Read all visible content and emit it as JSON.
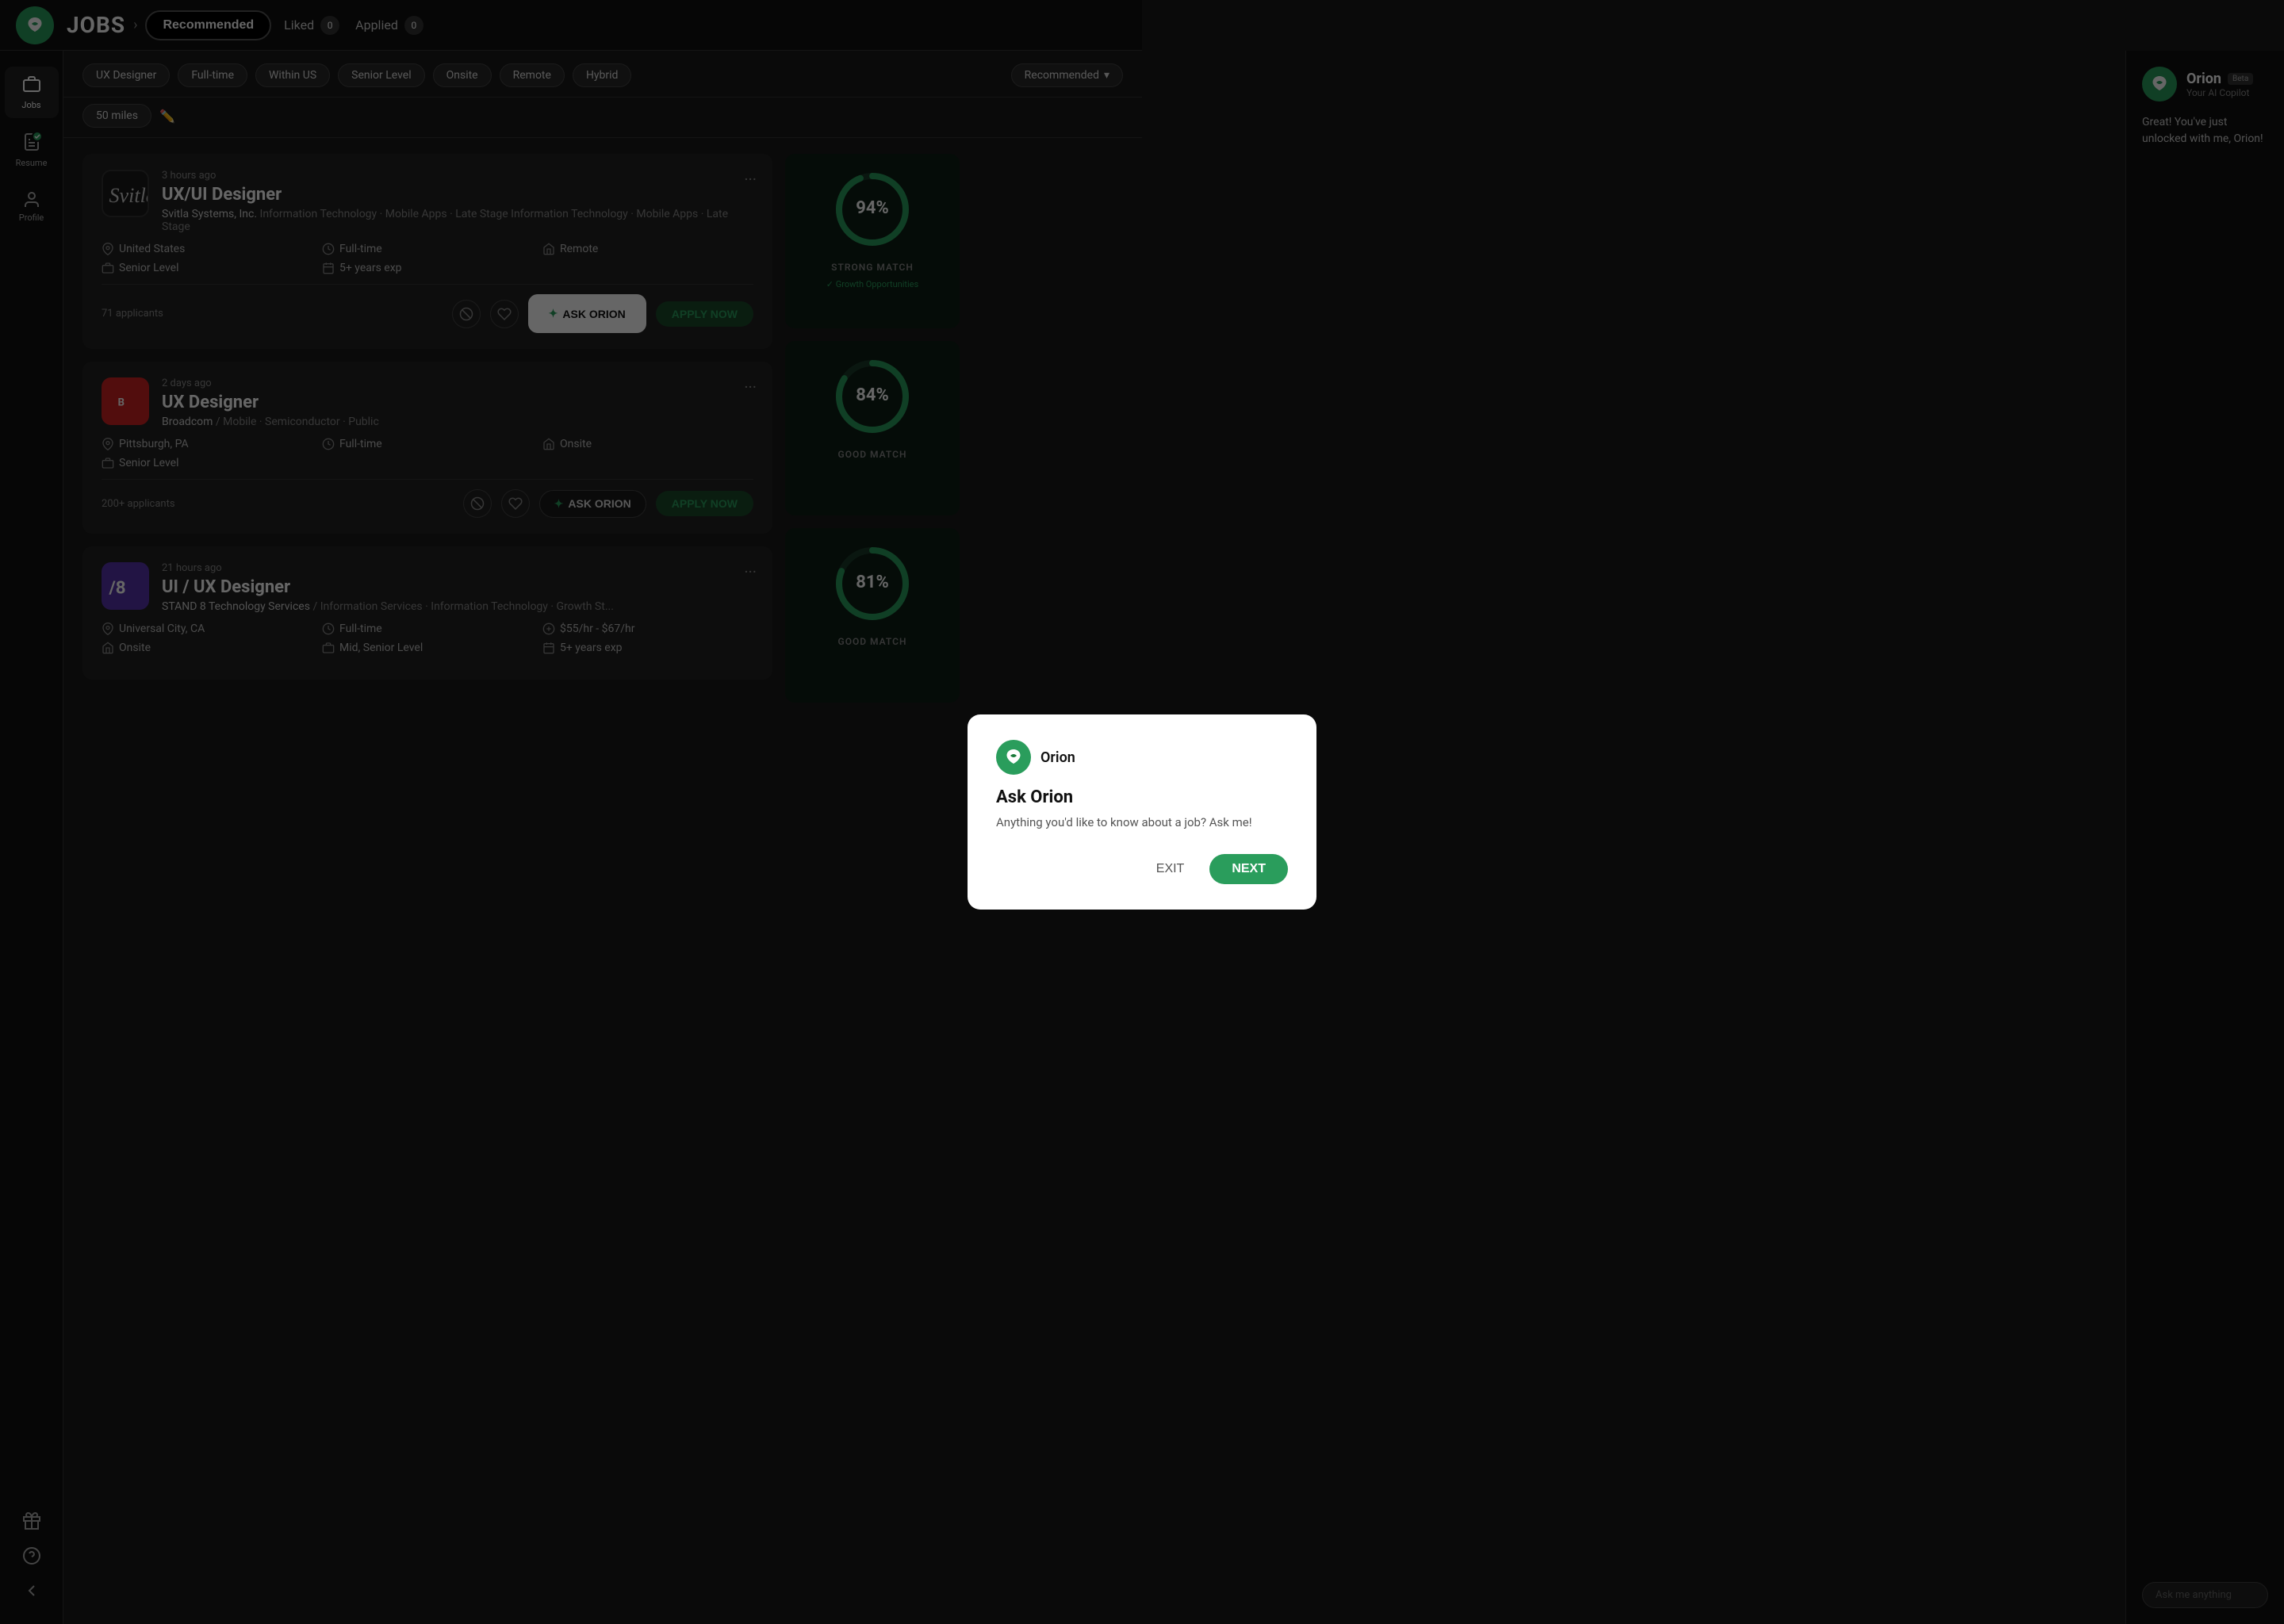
{
  "topNav": {
    "title": "JOBS",
    "tabs": [
      {
        "id": "recommended",
        "label": "Recommended",
        "active": true
      },
      {
        "id": "liked",
        "label": "Liked",
        "count": 0
      },
      {
        "id": "applied",
        "label": "Applied",
        "count": 0
      }
    ]
  },
  "filters": {
    "tags": [
      "UX Designer",
      "Full-time",
      "Within US",
      "Senior Level",
      "Onsite",
      "Remote",
      "Hybrid"
    ],
    "distance": "50 miles",
    "sort": "Recommended"
  },
  "jobs": [
    {
      "id": "job1",
      "time": "3 hours ago",
      "title": "UX/UI Designer",
      "company": "Svitla Systems, Inc.",
      "industry": "Information Technology · Mobile Apps · Late Stage",
      "location": "United States",
      "type": "Full-time",
      "workMode": "Remote",
      "level": "Senior Level",
      "experience": "5+ years exp",
      "applicants": "71 applicants",
      "match": 94,
      "matchLabel": "STRONG MATCH",
      "matchTag": "Growth Opportunities"
    },
    {
      "id": "job2",
      "time": "2 days ago",
      "title": "UX Designer",
      "company": "Broadcom",
      "industry": "Mobile · Semiconductor · Public",
      "location": "Pittsburgh, PA",
      "type": "Full-time",
      "workMode": "Onsite",
      "level": "Senior Level",
      "experience": "",
      "applicants": "200+ applicants",
      "match": 84,
      "matchLabel": "GOOD MATCH",
      "matchTag": ""
    },
    {
      "id": "job3",
      "time": "21 hours ago",
      "title": "UI / UX Designer",
      "company": "STAND 8 Technology Services",
      "industry": "Information Services · Information Technology · Growth St...",
      "location": "Universal City, CA",
      "type": "Full-time",
      "workMode": "Onsite",
      "level": "Mid, Senior Level",
      "experience": "5+ years exp",
      "salary": "$55/hr - $67/hr",
      "applicants": "",
      "match": 81,
      "matchLabel": "GOOD MATCH",
      "matchTag": ""
    }
  ],
  "orionSidebar": {
    "name": "Orion",
    "beta": "Beta",
    "subtitle": "Your AI Copilot",
    "message": "Great! You've just unlocked with me, Orion!",
    "askPlaceholder": "Ask me anything"
  },
  "modal": {
    "orionName": "Orion",
    "title": "Ask Orion",
    "description": "Anything you'd like to know about a job? Ask me!",
    "exitLabel": "EXIT",
    "nextLabel": "NEXT"
  },
  "askOrionBtn": "ASK ORION",
  "applyNowBtn": "APPLY NOW",
  "sidebar": {
    "items": [
      {
        "id": "jobs",
        "label": "Jobs",
        "active": true
      },
      {
        "id": "resume",
        "label": "Resume",
        "active": false
      },
      {
        "id": "profile",
        "label": "Profile",
        "active": false
      }
    ],
    "bottomItems": [
      {
        "id": "gifts",
        "label": ""
      },
      {
        "id": "help",
        "label": ""
      },
      {
        "id": "back",
        "label": ""
      }
    ]
  }
}
